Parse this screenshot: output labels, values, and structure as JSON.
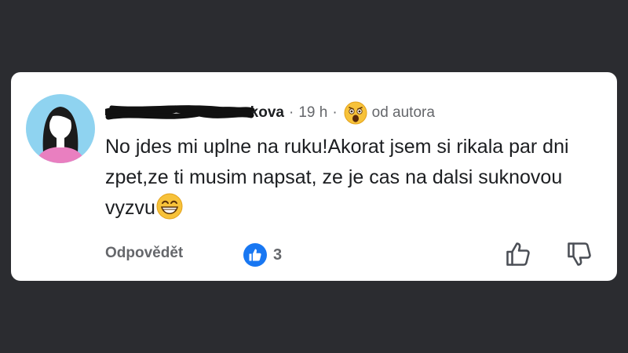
{
  "comment": {
    "author_visible": "ukova",
    "timestamp": "19 h",
    "separator": "·",
    "reaction_emoji": "astonished-face-emoji",
    "author_badge": "od autora",
    "text": "No jdes mi uplne na ruku!Akorat jsem si rikala par dni zpet,ze ti musim napsat, ze je cas na dalsi suknovou vyzvu",
    "text_emoji": "grinning-face-emoji",
    "reply_label": "Odpovědět",
    "like_count": "3"
  },
  "icons": {
    "avatar": "female-avatar-icon",
    "like_badge": "thumbs-up-badge-icon",
    "like": "thumbs-up-icon",
    "dislike": "thumbs-down-icon"
  },
  "colors": {
    "background": "#2b2c30",
    "card": "#ffffff",
    "text": "#1c1e21",
    "secondary_text": "#65676b",
    "like_blue": "#1877f2",
    "avatar_bg": "#8fd3f0",
    "avatar_shirt": "#e97fc0"
  }
}
